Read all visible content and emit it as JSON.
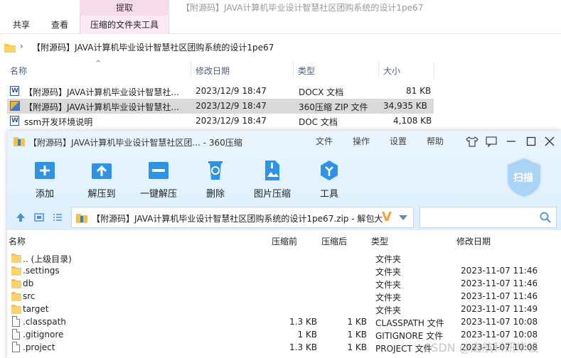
{
  "explorer": {
    "context_tab_group": "提取",
    "window_title": "【附源码】JAVA计算机毕业设计智慧社区团购系统的设计1pe67",
    "tabs": [
      "共享",
      "查看",
      "压缩的文件夹工具"
    ],
    "address_path": "【附源码】JAVA计算机毕业设计智慧社区团购系统的设计1pe67",
    "columns": {
      "name": "名称",
      "modified": "修改日期",
      "type": "类型",
      "size": "大小"
    },
    "files": [
      {
        "name": "【附源码】JAVA计算机毕业设计智慧社...",
        "modified": "2023/12/9 18:47",
        "type": "DOCX 文档",
        "size": "81 KB",
        "icon": "word-doc-icon"
      },
      {
        "name": "【附源码】JAVA计算机毕业设计智慧社...",
        "modified": "2023/12/9 18:47",
        "type": "360压缩 ZIP 文件",
        "size": "34,935 KB",
        "icon": "zip-archive-icon",
        "selected": true
      },
      {
        "name": "ssm开发环境说明",
        "modified": "2023/12/9 18:47",
        "type": "DOC 文档",
        "size": "4,108 KB",
        "icon": "word-doc-icon"
      }
    ]
  },
  "zip": {
    "title": "【附源码】JAVA计算机毕业设计智慧社区团... - 360压缩",
    "menu": [
      "文件",
      "操作",
      "设置",
      "帮助"
    ],
    "toolbar": [
      "添加",
      "解压到",
      "一键解压",
      "删除",
      "图片压缩",
      "工具"
    ],
    "brand_badge": "扫描",
    "path": "【附源码】JAVA计算机毕业设计智慧社区团购系统的设计1pe67.zip - 解包大",
    "search_placeholder": "",
    "columns": {
      "name": "名称",
      "compressed": "压缩前",
      "after": "压缩后",
      "type": "类型",
      "modified": "修改日期"
    },
    "rows": [
      {
        "name": ".. (上级目录)",
        "before": "",
        "after": "",
        "type": "文件夹",
        "modified": "",
        "icon": "folder-icon"
      },
      {
        "name": ".settings",
        "before": "",
        "after": "",
        "type": "文件夹",
        "modified": "2023-11-07 11:46",
        "icon": "folder-icon"
      },
      {
        "name": "db",
        "before": "",
        "after": "",
        "type": "文件夹",
        "modified": "2023-11-07 11:46",
        "icon": "folder-icon"
      },
      {
        "name": "src",
        "before": "",
        "after": "",
        "type": "文件夹",
        "modified": "2023-11-07 11:46",
        "icon": "folder-icon"
      },
      {
        "name": "target",
        "before": "",
        "after": "",
        "type": "文件夹",
        "modified": "2023-11-07 11:49",
        "icon": "folder-icon"
      },
      {
        "name": ".classpath",
        "before": "1.3 KB",
        "after": "1 KB",
        "type": "CLASSPATH 文件",
        "modified": "2023-11-07 10:08",
        "icon": "file-icon"
      },
      {
        "name": ".gitignore",
        "before": "1 KB",
        "after": "1 KB",
        "type": "GITIGNORE 文件",
        "modified": "2023-11-07 10:08",
        "icon": "file-icon"
      },
      {
        "name": ".project",
        "before": "1.3 KB",
        "after": "1 KB",
        "type": "PROJECT 文件",
        "modified": "2023-11-07 10:08",
        "icon": "file-icon"
      }
    ]
  },
  "watermark": "CSDN @启航科研毕设",
  "colors": {
    "accent": "#2e93e6",
    "selected_row": "#d9d9d9",
    "context_tab": "#f6dcea",
    "folder": "#f5c342"
  }
}
